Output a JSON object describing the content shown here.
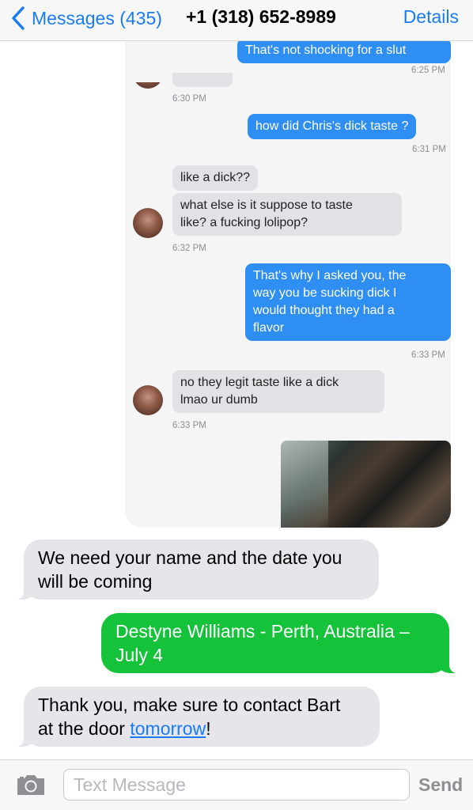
{
  "header": {
    "back_label": "Messages (435)",
    "contact": "+1 (318) 652-8989",
    "details_label": "Details"
  },
  "embedded": {
    "messages": [
      {
        "direction": "outgoing",
        "text": "That's not shocking for a slut"
      },
      {
        "direction": "time",
        "text": "6:25 PM"
      },
      {
        "direction": "time",
        "text": "6:30 PM"
      },
      {
        "direction": "outgoing",
        "text": "how did Chris's dick taste ?"
      },
      {
        "direction": "time",
        "text": "6:31 PM"
      },
      {
        "direction": "incoming",
        "text": "like a dick??"
      },
      {
        "direction": "incoming",
        "lines": [
          "what else is it suppose to taste",
          "like? a fucking lolipop?"
        ]
      },
      {
        "direction": "time",
        "text": "6:32 PM"
      },
      {
        "direction": "outgoing",
        "lines": [
          "That's why I asked you, the",
          "way you be sucking dick I",
          "would thought they had a",
          "flavor"
        ]
      },
      {
        "direction": "time",
        "text": "6:33 PM"
      },
      {
        "direction": "incoming",
        "lines": [
          "no they legit taste like a dick",
          "lmao ur dumb"
        ]
      },
      {
        "direction": "time",
        "text": "6:33 PM"
      }
    ]
  },
  "conversation": {
    "msg1": {
      "direction": "incoming",
      "lines": [
        "We need your name and the date you",
        "will be coming"
      ]
    },
    "msg2": {
      "direction": "outgoing",
      "lines": [
        "Destyne Williams - Perth, Australia –",
        "July 4"
      ]
    },
    "msg3": {
      "direction": "incoming",
      "line1": "Thank you, make sure to contact Bart",
      "line2_pre": "at the door ",
      "line2_link": "tomorrow",
      "line2_post": "!"
    }
  },
  "composer": {
    "placeholder": "Text Message",
    "value": "",
    "send_label": "Send"
  },
  "colors": {
    "ios_blue": "#1a7cf5",
    "imessage_blue": "#2f8ef2",
    "sms_green": "#15c33b",
    "incoming_gray": "#e5e5ea"
  },
  "icons": {
    "back": "chevron-left-icon",
    "camera": "camera-icon"
  }
}
